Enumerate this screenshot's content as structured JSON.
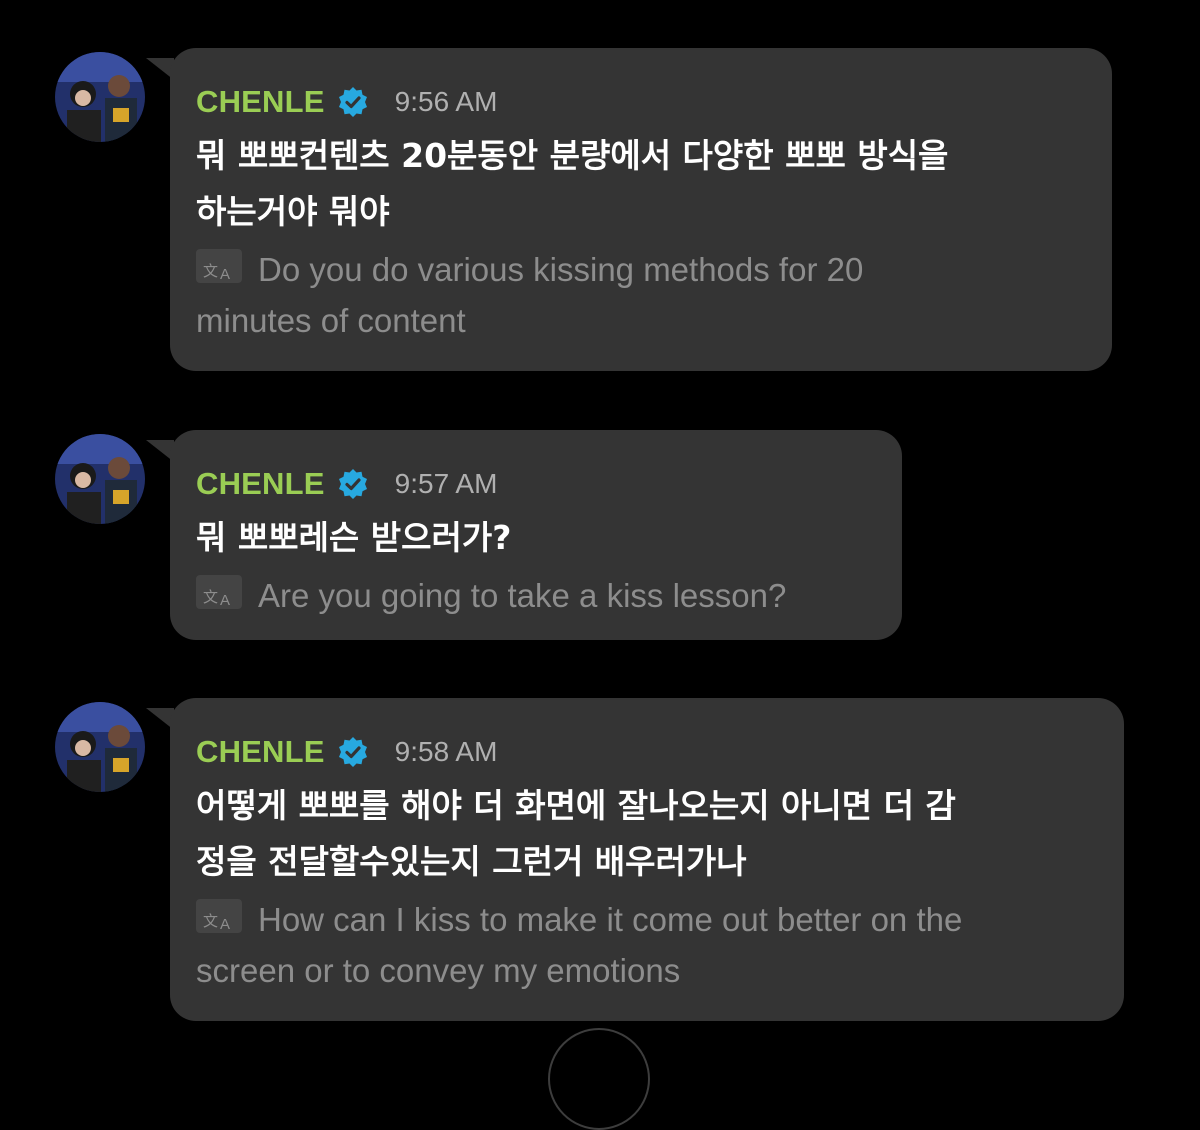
{
  "colors": {
    "background": "#000000",
    "bubble": "#343434",
    "name": "#9acd54",
    "verified": "#27a9e0",
    "time": "#b0b0b0",
    "body_text": "#ffffff",
    "translation_text": "#8d8d8d"
  },
  "icons": {
    "verified": "verified-badge-icon",
    "translate": "translate-icon"
  },
  "messages": [
    {
      "sender": "CHENLE",
      "time": "9:56 AM",
      "text": "뭐 뽀뽀컨텐츠 20분동안 분량에서 다양한 뽀뽀 방식을\n하는거야 뭐야",
      "translation": "Do you do various kissing methods for 20\nminutes of content"
    },
    {
      "sender": "CHENLE",
      "time": "9:57 AM",
      "text": "뭐 뽀뽀레슨 받으러가?",
      "translation": "Are you going to take a kiss lesson?"
    },
    {
      "sender": "CHENLE",
      "time": "9:58 AM",
      "text": "어떻게 뽀뽀를 해야 더 화면에 잘나오는지 아니면 더 감\n정을 전달할수있는지 그런거 배우러가나",
      "translation": "How can I kiss to make it come out better on the\nscreen or to convey my emotions"
    }
  ]
}
